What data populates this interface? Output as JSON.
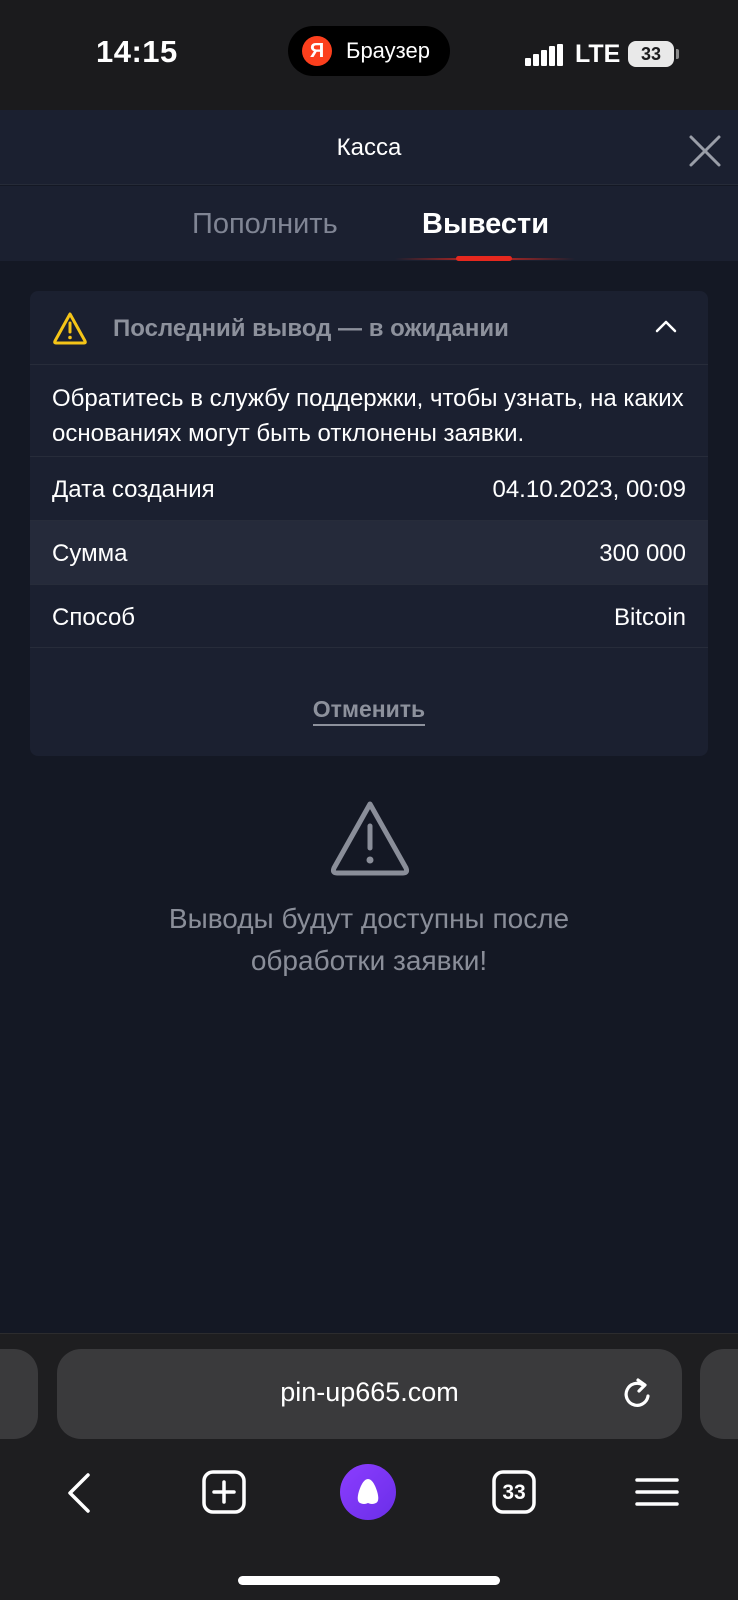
{
  "status_bar": {
    "time": "14:15",
    "browser_pill_label": "Браузер",
    "browser_logo_letter": "Я",
    "network": "LTE",
    "battery": "33"
  },
  "header": {
    "title": "Касса"
  },
  "tabs": [
    {
      "label": "Пополнить",
      "active": false
    },
    {
      "label": "Вывести",
      "active": true
    }
  ],
  "card": {
    "title": "Последний вывод — в ожидании",
    "note": "Обратитесь в службу поддержки, чтобы узнать, на каких основаниях могут быть отклонены заявки.",
    "rows": [
      {
        "label": "Дата создания",
        "value": "04.10.2023, 00:09"
      },
      {
        "label": "Сумма",
        "value": "300 000"
      },
      {
        "label": "Способ",
        "value": "Bitcoin"
      }
    ],
    "cancel_label": "Отменить"
  },
  "empty_state": {
    "line1": "Выводы будут доступны после",
    "line2": "обработки заявки!"
  },
  "browser": {
    "url": "pin-up665.com",
    "tabs_count": "33"
  },
  "colors": {
    "accent": "#e6281e",
    "warning": "#f5c518",
    "background": "#141824",
    "card": "#1b2030",
    "alice": "#7b34f5"
  }
}
